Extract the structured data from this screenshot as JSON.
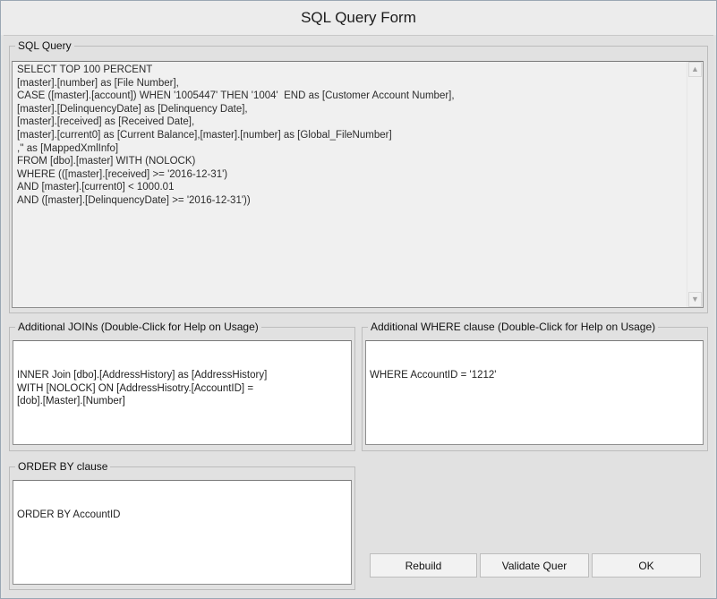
{
  "window": {
    "title": "SQL Query Form"
  },
  "sql_query": {
    "label": "SQL Query",
    "text": "SELECT TOP 100 PERCENT\n[master].[number] as [File Number],\nCASE ([master].[account]) WHEN '1005447' THEN '1004'  END as [Customer Account Number],\n[master].[DelinquencyDate] as [Delinquency Date],\n[master].[received] as [Received Date],\n[master].[current0] as [Current Balance],[master].[number] as [Global_FileNumber]\n,'' as [MappedXmlInfo]\nFROM [dbo].[master] WITH (NOLOCK)\nWHERE (([master].[received] >= '2016-12-31')\nAND [master].[current0] < 1000.01\nAND ([master].[DelinquencyDate] >= '2016-12-31'))"
  },
  "joins": {
    "label": "Additional JOINs (Double-Click for Help on Usage)",
    "text": "INNER Join [dbo].[AddressHistory] as [AddressHistory]\nWITH [NOLOCK] ON [AddressHisotry.[AccountID] =\n[dob].[Master].[Number]"
  },
  "where": {
    "label": "Additional WHERE clause  (Double-Click for Help on Usage)",
    "text": "WHERE AccountID = '1212'"
  },
  "order_by": {
    "label": "ORDER BY clause",
    "text": "ORDER BY AccountID"
  },
  "buttons": {
    "rebuild": "Rebuild",
    "validate": "Validate Quer",
    "ok": "OK"
  }
}
